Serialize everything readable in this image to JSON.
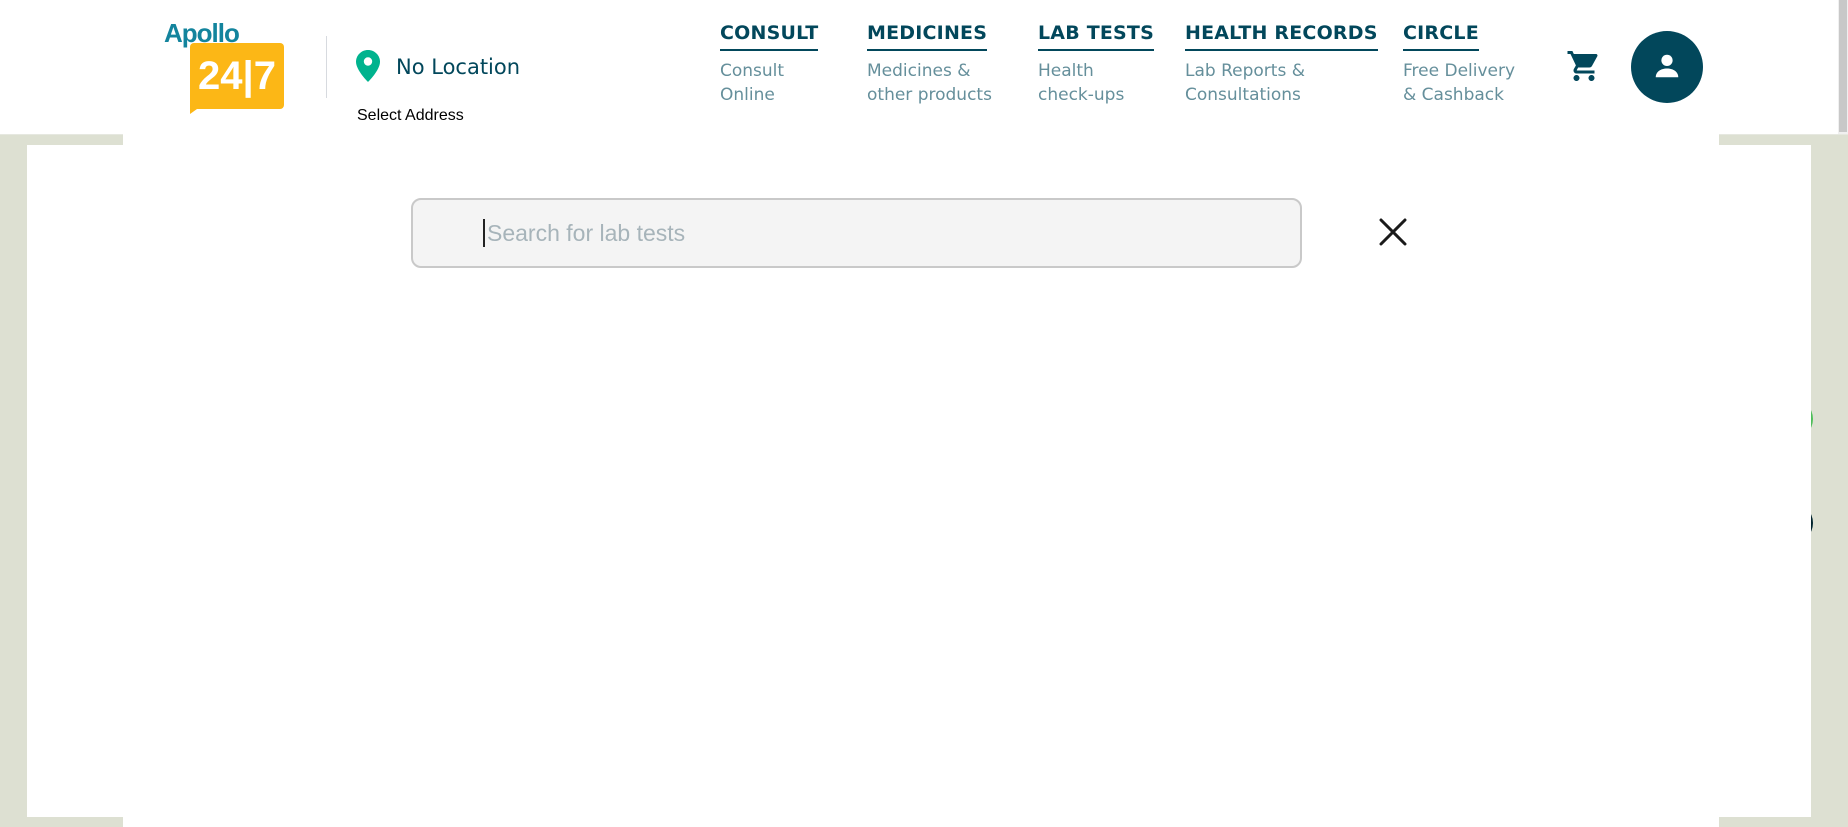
{
  "logo": {
    "brand": "Apollo",
    "number": "24|7"
  },
  "location": {
    "label": "No Location",
    "select_address": "Select Address"
  },
  "nav": [
    {
      "title": "CONSULT",
      "subtitle": "Consult\nOnline"
    },
    {
      "title": "MEDICINES",
      "subtitle": "Medicines &\nother products"
    },
    {
      "title": "LAB TESTS",
      "subtitle": "Health\ncheck-ups"
    },
    {
      "title": "HEALTH RECORDS",
      "subtitle": "Lab Reports &\nConsultations"
    },
    {
      "title": "CIRCLE",
      "subtitle": "Free Delivery\n& Cashback"
    }
  ],
  "search": {
    "placeholder": "Search for lab tests",
    "value": ""
  },
  "icons": {
    "location": "location-pin-icon",
    "cart": "cart-icon",
    "profile": "profile-icon",
    "close": "close-icon"
  },
  "colors": {
    "brand_dark": "#02475b",
    "brand_teal": "#13849d",
    "brand_yellow": "#fcb716",
    "location_pin": "#00b38e",
    "nav_sub": "#658f9b",
    "backdrop": "#dde0d2"
  }
}
